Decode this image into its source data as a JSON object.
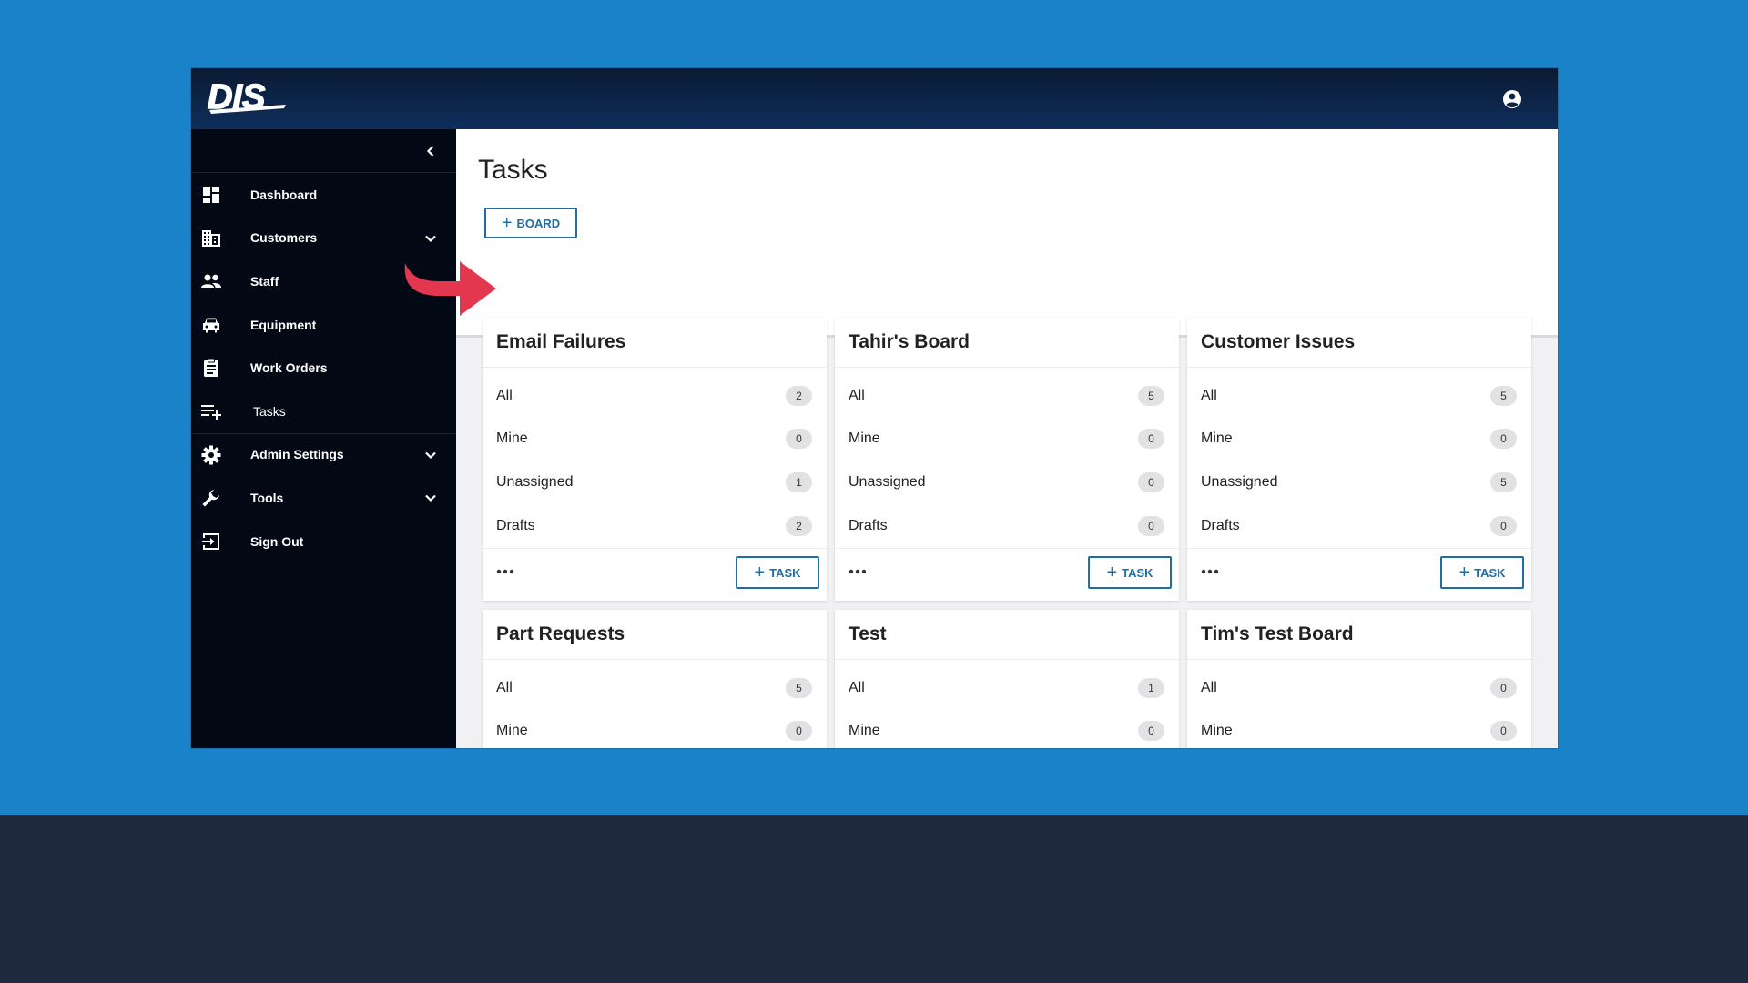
{
  "app": {
    "logo_text": "DIS"
  },
  "sidebar": {
    "items": [
      {
        "label": "Dashboard",
        "icon": "dashboard-icon"
      },
      {
        "label": "Customers",
        "icon": "building-icon",
        "expandable": true
      },
      {
        "label": "Staff",
        "icon": "people-icon"
      },
      {
        "label": "Equipment",
        "icon": "car-icon"
      },
      {
        "label": "Work Orders",
        "icon": "clipboard-icon"
      },
      {
        "label": "Tasks",
        "icon": "playlist-add-icon",
        "active": true
      },
      {
        "label": "Admin Settings",
        "icon": "gear-icon",
        "expandable": true
      },
      {
        "label": "Tools",
        "icon": "wrench-icon",
        "expandable": true
      },
      {
        "label": "Sign Out",
        "icon": "sign-out-icon"
      }
    ]
  },
  "main": {
    "title": "Tasks",
    "board_button": "BOARD",
    "task_button": "TASK"
  },
  "boards": [
    {
      "title": "Email Failures",
      "rows": [
        {
          "label": "All",
          "count": "2"
        },
        {
          "label": "Mine",
          "count": "0"
        },
        {
          "label": "Unassigned",
          "count": "1"
        },
        {
          "label": "Drafts",
          "count": "2"
        }
      ]
    },
    {
      "title": "Tahir's Board",
      "rows": [
        {
          "label": "All",
          "count": "5"
        },
        {
          "label": "Mine",
          "count": "0"
        },
        {
          "label": "Unassigned",
          "count": "0"
        },
        {
          "label": "Drafts",
          "count": "0"
        }
      ]
    },
    {
      "title": "Customer Issues",
      "rows": [
        {
          "label": "All",
          "count": "5"
        },
        {
          "label": "Mine",
          "count": "0"
        },
        {
          "label": "Unassigned",
          "count": "5"
        },
        {
          "label": "Drafts",
          "count": "0"
        }
      ]
    },
    {
      "title": "Part Requests",
      "rows": [
        {
          "label": "All",
          "count": "5"
        },
        {
          "label": "Mine",
          "count": "0"
        }
      ]
    },
    {
      "title": "Test",
      "rows": [
        {
          "label": "All",
          "count": "1"
        },
        {
          "label": "Mine",
          "count": "0"
        }
      ]
    },
    {
      "title": "Tim's Test Board",
      "rows": [
        {
          "label": "All",
          "count": "0"
        },
        {
          "label": "Mine",
          "count": "0"
        }
      ]
    }
  ],
  "colors": {
    "background_blue": "#1a82c9",
    "background_dark": "#1f2a40",
    "header_navy": "#0f2e5c",
    "sidebar_black": "#030914",
    "accent_blue": "#1e6fa8",
    "annotation_arrow": "#e2374e"
  }
}
